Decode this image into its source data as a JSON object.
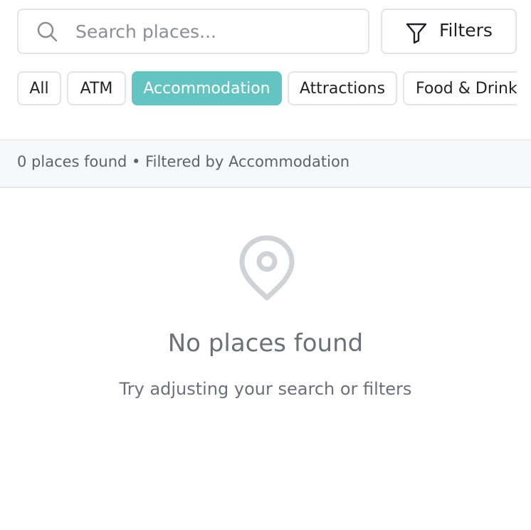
{
  "search": {
    "placeholder": "Search places...",
    "value": "",
    "icon": "search-icon"
  },
  "filters_button": {
    "label": "Filters",
    "icon": "filter-icon"
  },
  "categories": [
    {
      "label": "All",
      "active": false
    },
    {
      "label": "ATM",
      "active": false
    },
    {
      "label": "Accommodation",
      "active": true
    },
    {
      "label": "Attractions",
      "active": false
    },
    {
      "label": "Food & Drink",
      "active": false
    }
  ],
  "results": {
    "summary": "0 places found • Filtered by Accommodation"
  },
  "empty_state": {
    "icon": "map-pin-icon",
    "title": "No places found",
    "subtitle": "Try adjusting your search or filters"
  },
  "colors": {
    "accent": "#63c4c2",
    "border": "#e2e5e9",
    "muted_text": "#6b7079",
    "icon_gray": "#cfd2d7"
  }
}
